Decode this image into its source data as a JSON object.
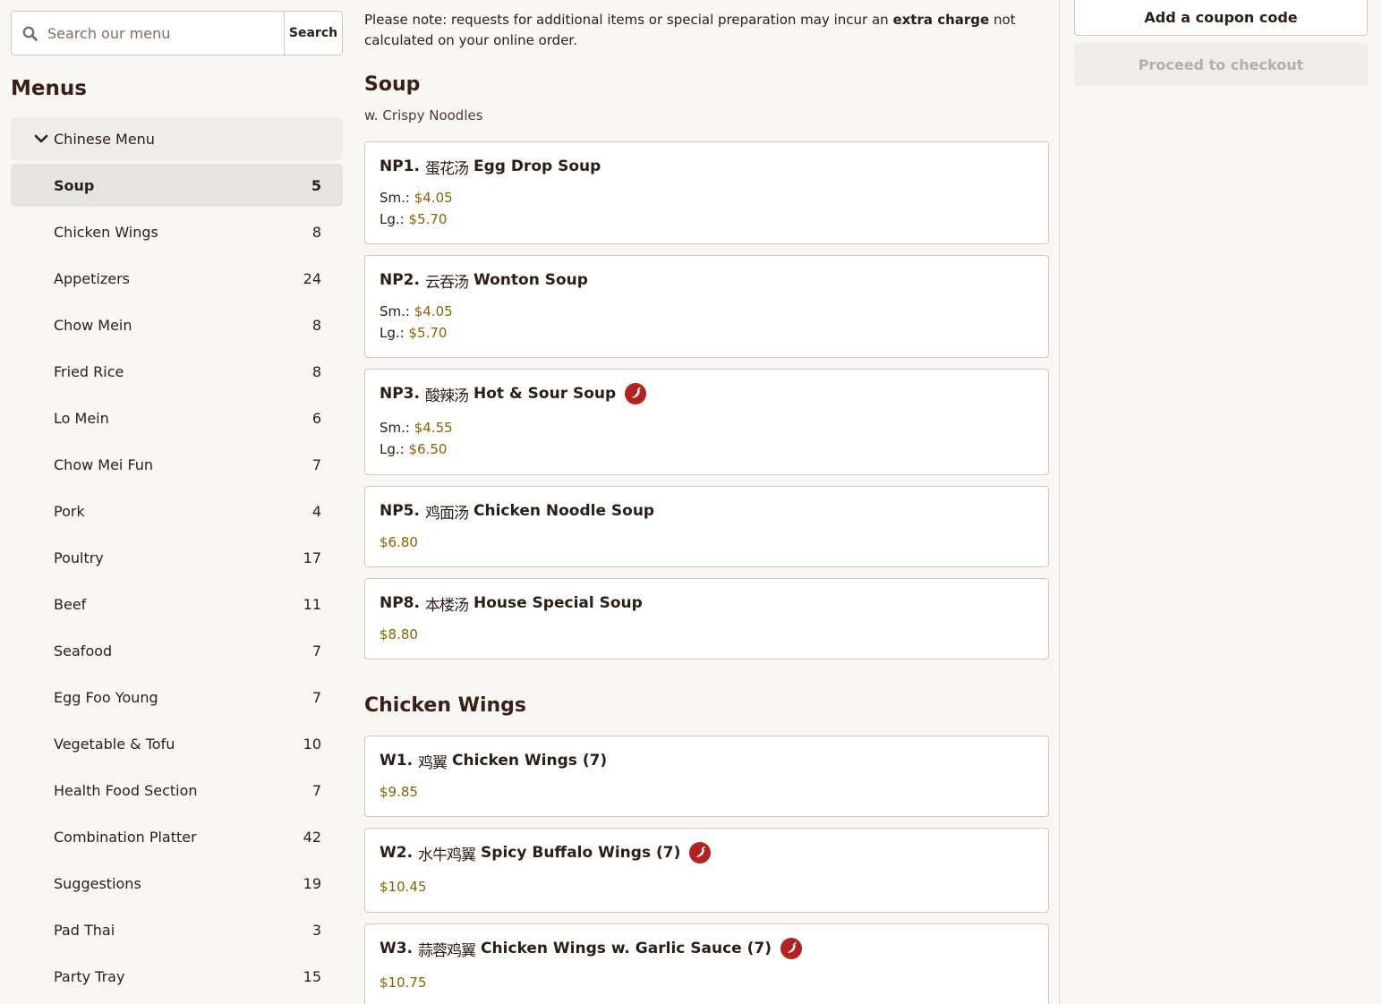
{
  "search": {
    "placeholder": "Search our menu",
    "button_label": "Search"
  },
  "sidebar": {
    "heading": "Menus",
    "group_label": "Chinese Menu",
    "categories": [
      {
        "label": "Soup",
        "count": "5"
      },
      {
        "label": "Chicken Wings",
        "count": "8"
      },
      {
        "label": "Appetizers",
        "count": "24"
      },
      {
        "label": "Chow Mein",
        "count": "8"
      },
      {
        "label": "Fried Rice",
        "count": "8"
      },
      {
        "label": "Lo Mein",
        "count": "6"
      },
      {
        "label": "Chow Mei Fun",
        "count": "7"
      },
      {
        "label": "Pork",
        "count": "4"
      },
      {
        "label": "Poultry",
        "count": "17"
      },
      {
        "label": "Beef",
        "count": "11"
      },
      {
        "label": "Seafood",
        "count": "7"
      },
      {
        "label": "Egg Foo Young",
        "count": "7"
      },
      {
        "label": "Vegetable & Tofu",
        "count": "10"
      },
      {
        "label": "Health Food Section",
        "count": "7"
      },
      {
        "label": "Combination Platter",
        "count": "42"
      },
      {
        "label": "Suggestions",
        "count": "19"
      },
      {
        "label": "Pad Thai",
        "count": "3"
      },
      {
        "label": "Party Tray",
        "count": "15"
      }
    ]
  },
  "notice": {
    "before": "Please note: requests for additional items or special preparation may incur an ",
    "bold": "extra charge",
    "after": " not calculated on your online order."
  },
  "sections": {
    "soup": {
      "title": "Soup",
      "subtitle": "w. Crispy Noodles",
      "items": [
        {
          "code": "NP1.",
          "zh": "蛋花汤",
          "name": "Egg Drop Soup",
          "prices": [
            {
              "label": "Sm.:",
              "price": "$4.05"
            },
            {
              "label": "Lg.:",
              "price": "$5.70"
            }
          ]
        },
        {
          "code": "NP2.",
          "zh": "云吞汤",
          "name": "Wonton Soup",
          "prices": [
            {
              "label": "Sm.:",
              "price": "$4.05"
            },
            {
              "label": "Lg.:",
              "price": "$5.70"
            }
          ]
        },
        {
          "code": "NP3.",
          "zh": "酸辣汤",
          "name": "Hot & Sour Soup",
          "spicy": true,
          "prices": [
            {
              "label": "Sm.:",
              "price": "$4.55"
            },
            {
              "label": "Lg.:",
              "price": "$6.50"
            }
          ]
        },
        {
          "code": "NP5.",
          "zh": "鸡面汤",
          "name": "Chicken Noodle Soup",
          "price": "$6.80"
        },
        {
          "code": "NP8.",
          "zh": "本楼汤",
          "name": "House Special Soup",
          "price": "$8.80"
        }
      ]
    },
    "wings": {
      "title": "Chicken Wings",
      "items": [
        {
          "code": "W1.",
          "zh": "鸡翼",
          "name": "Chicken Wings (7)",
          "price": "$9.85"
        },
        {
          "code": "W2.",
          "zh": "水牛鸡翼",
          "name": "Spicy Buffalo Wings (7)",
          "spicy": true,
          "price": "$10.45"
        },
        {
          "code": "W3.",
          "zh": "蒜蓉鸡翼",
          "name": "Chicken Wings w. Garlic Sauce (7)",
          "spicy": true,
          "price": "$10.75"
        }
      ]
    }
  },
  "cart": {
    "coupon_label": "Add a coupon code",
    "checkout_label": "Proceed to checkout"
  },
  "colors": {
    "price": "#8a6200",
    "spicy": "#b22222",
    "active_bg": "#e6e4e1"
  },
  "icons": {
    "search": "search-icon",
    "chevron": "chevron-down-icon",
    "spicy": "chili-pepper-icon"
  }
}
